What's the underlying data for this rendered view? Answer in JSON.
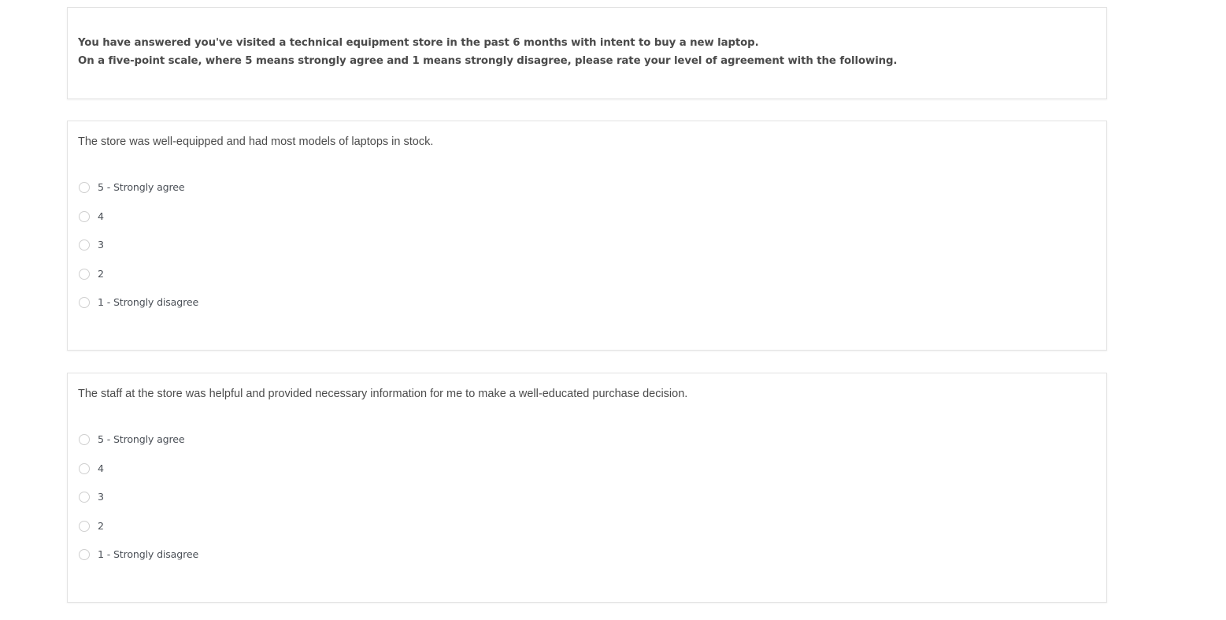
{
  "survey": {
    "intro": {
      "line1": "You have answered you've visited a technical equipment store in the past 6 months with intent to buy a new laptop.",
      "line2": "On a five-point scale, where 5 means strongly agree and 1 means strongly disagree, please rate your level of agreement with the following."
    },
    "questions": [
      {
        "prompt": "The store was well-equipped and had most models of laptops in stock.",
        "options": [
          {
            "label": "5 - Strongly agree",
            "selected": false
          },
          {
            "label": "4",
            "selected": false
          },
          {
            "label": "3",
            "selected": false
          },
          {
            "label": "2",
            "selected": false
          },
          {
            "label": "1 - Strongly disagree",
            "selected": false
          }
        ]
      },
      {
        "prompt": "The staff at the store was helpful and provided necessary information for me to make a well-educated purchase decision.",
        "options": [
          {
            "label": "5 - Strongly agree",
            "selected": false
          },
          {
            "label": "4",
            "selected": false
          },
          {
            "label": "3",
            "selected": false
          },
          {
            "label": "2",
            "selected": false
          },
          {
            "label": "1 - Strongly disagree",
            "selected": false
          }
        ]
      }
    ],
    "colors": {
      "page_background": "#ffffff",
      "card_background": "#ffffff",
      "card_border": "#e3e3e3",
      "intro_text": "#4a4a4a",
      "question_text": "#4c4c4c",
      "option_text": "#4b5057",
      "radio_border": "#cfcfcf"
    }
  }
}
